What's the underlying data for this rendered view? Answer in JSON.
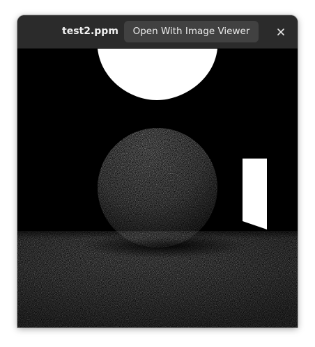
{
  "window": {
    "title": "test2.ppm",
    "open_with_label": "Open With Image Viewer",
    "close_icon": "close-icon"
  },
  "image": {
    "description_type": "rendered-scene",
    "colors": {
      "background": "#000000",
      "titlebar": "#2b2b2b",
      "button": "#414141"
    }
  }
}
